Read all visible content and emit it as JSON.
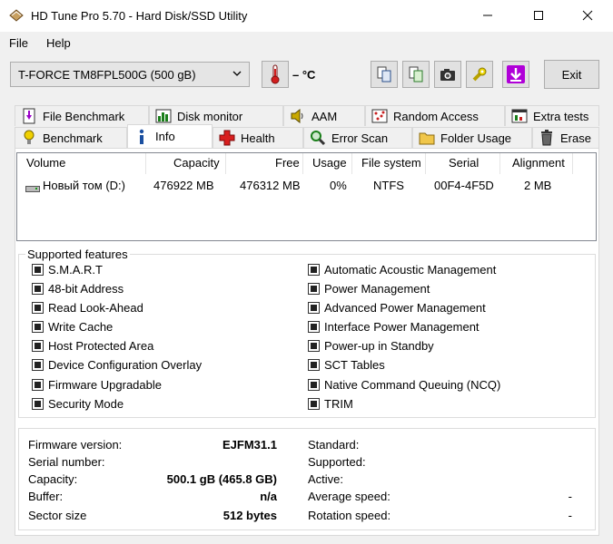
{
  "window": {
    "title": "HD Tune Pro 5.70 - Hard Disk/SSD Utility"
  },
  "menu": {
    "file": "File",
    "help": "Help"
  },
  "toolbar": {
    "drive": "T-FORCE TM8FPL500G (500 gB)",
    "temperature": "– °C",
    "exit": "Exit"
  },
  "tabs_top": [
    {
      "label": "File Benchmark",
      "icon": "file-benchmark-icon"
    },
    {
      "label": "Disk monitor",
      "icon": "disk-monitor-icon"
    },
    {
      "label": "AAM",
      "icon": "speaker-icon"
    },
    {
      "label": "Random Access",
      "icon": "random-access-icon"
    },
    {
      "label": "Extra tests",
      "icon": "extra-tests-icon"
    }
  ],
  "tabs_bottom": [
    {
      "label": "Benchmark",
      "icon": "lightbulb-icon"
    },
    {
      "label": "Info",
      "icon": "info-icon",
      "active": true
    },
    {
      "label": "Health",
      "icon": "health-cross-icon"
    },
    {
      "label": "Error Scan",
      "icon": "magnifier-icon"
    },
    {
      "label": "Folder Usage",
      "icon": "folder-icon"
    },
    {
      "label": "Erase",
      "icon": "trash-icon"
    }
  ],
  "volumes": {
    "headers": [
      "Volume",
      "Capacity",
      "Free",
      "Usage",
      "File system",
      "Serial",
      "Alignment"
    ],
    "rows": [
      [
        "Новый том (D:)",
        "476922 MB",
        "476312 MB",
        "0%",
        "NTFS",
        "00F4-4F5D",
        "2 MB"
      ]
    ]
  },
  "features": {
    "title": "Supported features",
    "left": [
      "S.M.A.R.T",
      "48-bit Address",
      "Read Look-Ahead",
      "Write Cache",
      "Host Protected Area",
      "Device Configuration Overlay",
      "Firmware Upgradable",
      "Security Mode"
    ],
    "right": [
      "Automatic Acoustic Management",
      "Power Management",
      "Advanced Power Management",
      "Interface Power Management",
      "Power-up in Standby",
      "SCT Tables",
      "Native Command Queuing (NCQ)",
      "TRIM"
    ]
  },
  "details": {
    "left": [
      {
        "label": "Firmware version:",
        "value": "EJFM31.1"
      },
      {
        "label": "Serial number:",
        "value": ""
      },
      {
        "label": "Capacity:",
        "value": "500.1 gB (465.8 GB)"
      },
      {
        "label": "Buffer:",
        "value": "n/a"
      },
      {
        "label": "Sector size",
        "value": "512 bytes"
      }
    ],
    "right": [
      {
        "label": "Standard:",
        "value": ""
      },
      {
        "label": "Supported:",
        "value": ""
      },
      {
        "label": "Active:",
        "value": ""
      },
      {
        "label": "Average speed:",
        "value": "-"
      },
      {
        "label": "Rotation speed:",
        "value": "-"
      }
    ]
  },
  "colors": {
    "accent_purple": "#b000d8",
    "thermometer_red": "#d21e1e"
  }
}
